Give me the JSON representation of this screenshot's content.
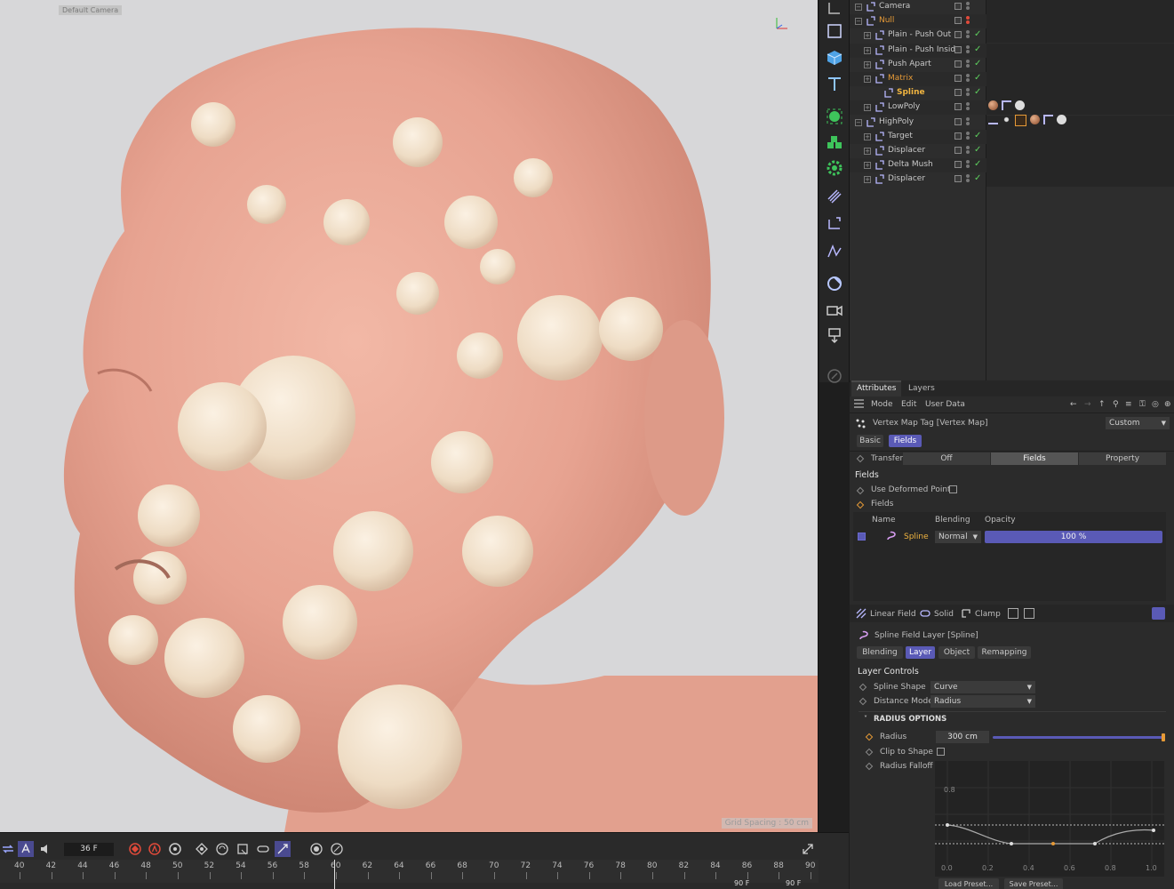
{
  "viewport": {
    "camera_label": "Default Camera",
    "grid_spacing": "Grid Spacing : 50 cm"
  },
  "toolbar": {
    "icons": [
      "move-icon",
      "cube-icon",
      "text-icon",
      "generator-icon",
      "mograph-icon",
      "effector-icon",
      "deformer-icon",
      "null-icon",
      "spline-icon",
      "field-icon",
      "camera-icon",
      "light-icon",
      "brush-icon"
    ]
  },
  "objects": [
    {
      "name": "Camera",
      "indent": 0,
      "style": "normal",
      "dot": "gray",
      "check": false
    },
    {
      "name": "Null",
      "indent": 0,
      "style": "orange",
      "dot": "red",
      "check": false
    },
    {
      "name": "Plain - Push Out",
      "indent": 1,
      "style": "normal",
      "dot": "gray",
      "check": true
    },
    {
      "name": "Plain - Push Inside",
      "indent": 1,
      "style": "normal",
      "dot": "gray",
      "check": true
    },
    {
      "name": "Push Apart",
      "indent": 1,
      "style": "normal",
      "dot": "gray",
      "check": true
    },
    {
      "name": "Matrix",
      "indent": 1,
      "style": "orange",
      "dot": "gray",
      "check": true
    },
    {
      "name": "Spline",
      "indent": 2,
      "style": "sel",
      "dot": "gray",
      "check": true
    },
    {
      "name": "LowPoly",
      "indent": 1,
      "style": "normal",
      "dot": "gray",
      "check": false
    },
    {
      "name": "HighPoly",
      "indent": 0,
      "style": "normal",
      "dot": "gray",
      "check": false
    },
    {
      "name": "Target",
      "indent": 1,
      "style": "normal",
      "dot": "gray",
      "check": true
    },
    {
      "name": "Displacer",
      "indent": 1,
      "style": "normal",
      "dot": "gray",
      "check": true
    },
    {
      "name": "Delta Mush",
      "indent": 1,
      "style": "normal",
      "dot": "gray",
      "check": true
    },
    {
      "name": "Displacer",
      "indent": 1,
      "style": "normal",
      "dot": "gray",
      "check": true
    }
  ],
  "attributes": {
    "tabs": [
      "Attributes",
      "Layers"
    ],
    "menu": [
      "Mode",
      "Edit",
      "User Data"
    ],
    "object_title": "Vertex Map Tag [Vertex Map]",
    "preset": "Custom",
    "subtabs": [
      "Basic",
      "Fields"
    ],
    "transfer_label": "Transfer",
    "transfer_options": [
      "Off",
      "Fields",
      "Property"
    ],
    "transfer_selected": "Fields",
    "fields_heading": "Fields",
    "use_deformed_points": "Use Deformed Points",
    "fields_label": "Fields",
    "list_columns": [
      "Name",
      "Blending",
      "Opacity"
    ],
    "list_row": {
      "name": "Spline",
      "blending": "Normal",
      "opacity": "100 %",
      "opacity_fraction": 1.0
    },
    "field_buttons": [
      "Linear Field",
      "Solid",
      "Clamp"
    ],
    "layer_title": "Spline Field Layer [Spline]",
    "layer_tabs": [
      "Blending",
      "Layer",
      "Object",
      "Remapping"
    ],
    "layer_tab_active": "Layer",
    "layer_controls": "Layer Controls",
    "spline_shape_label": "Spline Shape",
    "spline_shape_value": "Curve",
    "distance_mode_label": "Distance Mode",
    "distance_mode_value": "Radius",
    "radius_options": "RADIUS OPTIONS",
    "radius_label": "Radius",
    "radius_value": "300 cm",
    "radius_fraction": 1.0,
    "clip_label": "Clip to Shape",
    "falloff_label": "Radius Falloff",
    "graph_y_label": "0.8",
    "graph_x_ticks": [
      "0.0",
      "0.2",
      "0.4",
      "0.6",
      "0.8",
      "1.0"
    ],
    "load_preset": "Load Preset...",
    "save_preset": "Save Preset..."
  },
  "timeline": {
    "current_frame": "36 F",
    "ticks": [
      "40",
      "42",
      "44",
      "46",
      "48",
      "50",
      "52",
      "54",
      "56",
      "58",
      "60",
      "62",
      "64",
      "66",
      "68",
      "70",
      "72",
      "74",
      "76",
      "78",
      "80",
      "82",
      "84",
      "86",
      "88",
      "90"
    ],
    "end_a": "90 F",
    "end_b": "90 F"
  }
}
